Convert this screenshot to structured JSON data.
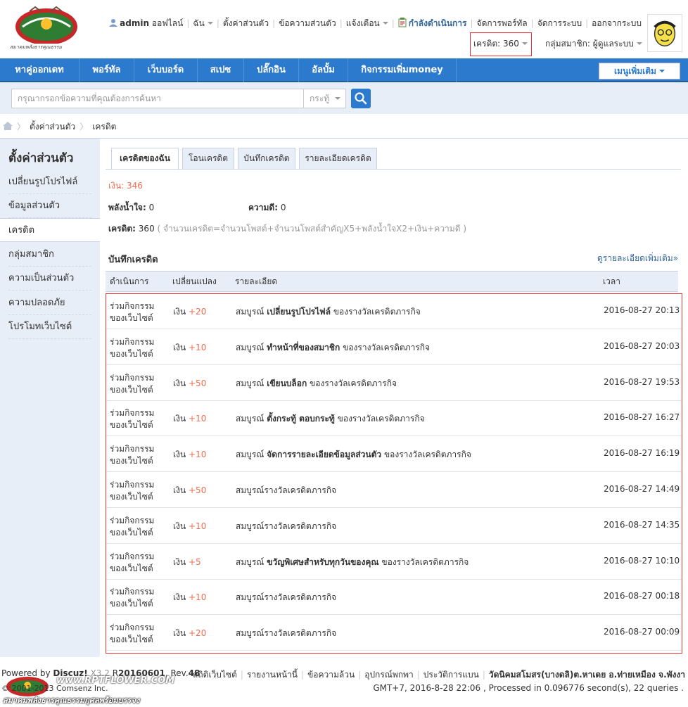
{
  "header": {
    "site_name": "สมาคมพลังธารคุณธรรม",
    "username": "admin",
    "status": "ออฟไลน์",
    "links": [
      "ฉัน",
      "ตั้งค่าส่วนตัว",
      "ข้อความส่วนตัว",
      "แจ้งเตือน"
    ],
    "in_progress": "กำลังดำเนินการ",
    "admin_links": [
      "จัดการพอร์ทัล",
      "จัดการระบบ",
      "ออกจากระบบ"
    ],
    "credit": "เครดิต: 360",
    "group": "กลุ่มสมาชิก: ผู้ดูแลระบบ"
  },
  "nav": {
    "items": [
      "หาคู่ออกเดท",
      "พอร์ทัล",
      "เว็บบอร์ด",
      "สเปซ",
      "ปลั๊กอิน",
      "อัลบั้ม",
      "กิจกรรมเพิ่มmoney"
    ],
    "more": "เมนูเพิ่มเติม"
  },
  "search": {
    "placeholder": "กรุณากรอกข้อความที่คุณต้องการค้นหา",
    "scope": "กระทู้"
  },
  "breadcrumb": [
    "ตั้งค่าส่วนตัว",
    "เครดิต"
  ],
  "sidebar": {
    "title": "ตั้งค่าส่วนตัว",
    "items": [
      "เปลี่ยนรูปโปรไฟล์",
      "ข้อมูลส่วนตัว",
      "เครดิต",
      "กลุ่มสมาชิก",
      "ความเป็นส่วนตัว",
      "ความปลอดภัย",
      "โปรโมทเว็บไซต์"
    ]
  },
  "tabs": [
    "เครดิตของฉัน",
    "โอนเครดิต",
    "บันทึกเครดิต",
    "รายละเอียดเครดิต"
  ],
  "summary": {
    "money": "เงิน: 346",
    "will_label": "พลังน้ำใจ:",
    "will_value": "0",
    "virtue_label": "ความดี:",
    "virtue_value": "0",
    "credit_label": "เครดิต:",
    "credit_value": "360",
    "formula": "( จำนวนเครดิต=จำนวนโพสต์+จำนวนโพสต์สำคัญX5+พลังน้ำใจX2+เงิน+ความดี )"
  },
  "log": {
    "title": "บันทึกเครดิต",
    "more": "ดูรายละเอียดเพิ่มเติม»",
    "headers": [
      "ดำเนินการ",
      "เปลี่ยนแปลง",
      "รายละเอียด",
      "เวลา"
    ],
    "rows": [
      {
        "action": "ร่วมกิจกรรมของเว็บไซต์",
        "unit": "เงิน",
        "amount": "+20",
        "pre": "สมบูรณ์ ",
        "bold": "เปลี่ยนรูปโปรไฟล์",
        "post": " ของรางวัลเครดิตภารกิจ",
        "time": "2016-08-27 20:13"
      },
      {
        "action": "ร่วมกิจกรรมของเว็บไซต์",
        "unit": "เงิน",
        "amount": "+10",
        "pre": "สมบูรณ์ ",
        "bold": "ทำหน้าที่ของสมาชิก",
        "post": " ของรางวัลเครดิตภารกิจ",
        "time": "2016-08-27 20:03"
      },
      {
        "action": "ร่วมกิจกรรมของเว็บไซต์",
        "unit": "เงิน",
        "amount": "+50",
        "pre": "สมบูรณ์ ",
        "bold": "เขียนบล็อก",
        "post": " ของรางวัลเครดิตภารกิจ",
        "time": "2016-08-27 19:53"
      },
      {
        "action": "ร่วมกิจกรรมของเว็บไซต์",
        "unit": "เงิน",
        "amount": "+10",
        "pre": "สมบูรณ์ ",
        "bold": "ตั้งกระทู้ ตอบกระทู้",
        "post": " ของรางวัลเครดิตภารกิจ",
        "time": "2016-08-27 16:27"
      },
      {
        "action": "ร่วมกิจกรรมของเว็บไซต์",
        "unit": "เงิน",
        "amount": "+10",
        "pre": "สมบูรณ์ ",
        "bold": "จัดการรายละเอียดข้อมูลส่วนตัว",
        "post": " ของรางวัลเครดิตภารกิจ",
        "time": "2016-08-27 16:19"
      },
      {
        "action": "ร่วมกิจกรรมของเว็บไซต์",
        "unit": "เงิน",
        "amount": "+50",
        "pre": "สมบูรณ์รางวัลเครดิตภารกิจ",
        "bold": "",
        "post": "",
        "time": "2016-08-27 14:49"
      },
      {
        "action": "ร่วมกิจกรรมของเว็บไซต์",
        "unit": "เงิน",
        "amount": "+10",
        "pre": "สมบูรณ์รางวัลเครดิตภารกิจ",
        "bold": "",
        "post": "",
        "time": "2016-08-27 14:35"
      },
      {
        "action": "ร่วมกิจกรรมของเว็บไซต์",
        "unit": "เงิน",
        "amount": "+5",
        "pre": "สมบูรณ์ ",
        "bold": "ขวัญพิเศษสำหรับทุกวันของคุณ",
        "post": " ของรางวัลเครดิตภารกิจ",
        "time": "2016-08-27 10:10"
      },
      {
        "action": "ร่วมกิจกรรมของเว็บไซต์",
        "unit": "เงิน",
        "amount": "+10",
        "pre": "สมบูรณ์รางวัลเครดิตภารกิจ",
        "bold": "",
        "post": "",
        "time": "2016-08-27 00:18"
      },
      {
        "action": "ร่วมกิจกรรมของเว็บไซต์",
        "unit": "เงิน",
        "amount": "+20",
        "pre": "สมบูรณ์รางวัลเครดิตภารกิจ",
        "bold": "",
        "post": "",
        "time": "2016-08-27 00:09"
      }
    ]
  },
  "footer": {
    "powered_prefix": "Powered by",
    "product": "Discuz!",
    "version": "X3.2",
    "release_prefix": "R",
    "release": "20160601",
    "rev_prefix": ", Rev.",
    "rev": "48",
    "links": [
      "สถิติเว็บไซต์",
      "รายงานหน้านี้",
      "ข้อความล้วน",
      "อุปกรณ์พกพา",
      "ประวัติการแบน"
    ],
    "org": "วัดนิคมสโมสร(บางดลิ)ต.หาเดย อ.ท่ายเหมือง จ.พังงา",
    "copyright": "© 2001-2013 Comsenz Inc.",
    "stats": "GMT+7, 2016-8-28 22:06 , Processed in 0.096776 second(s), 22 queries .",
    "watermark": "www.RPTFLOWER.COM",
    "watermark2": "สมาคมพลังธารคุณธรรมกุศลพร้อมบรรจง"
  },
  "colors": {
    "nav_bg": "#2b7acd",
    "accent_red": "#f26c4f",
    "highlight_box": "#e53333",
    "link_blue": "#336699",
    "panel_bg": "#e8eef7"
  }
}
